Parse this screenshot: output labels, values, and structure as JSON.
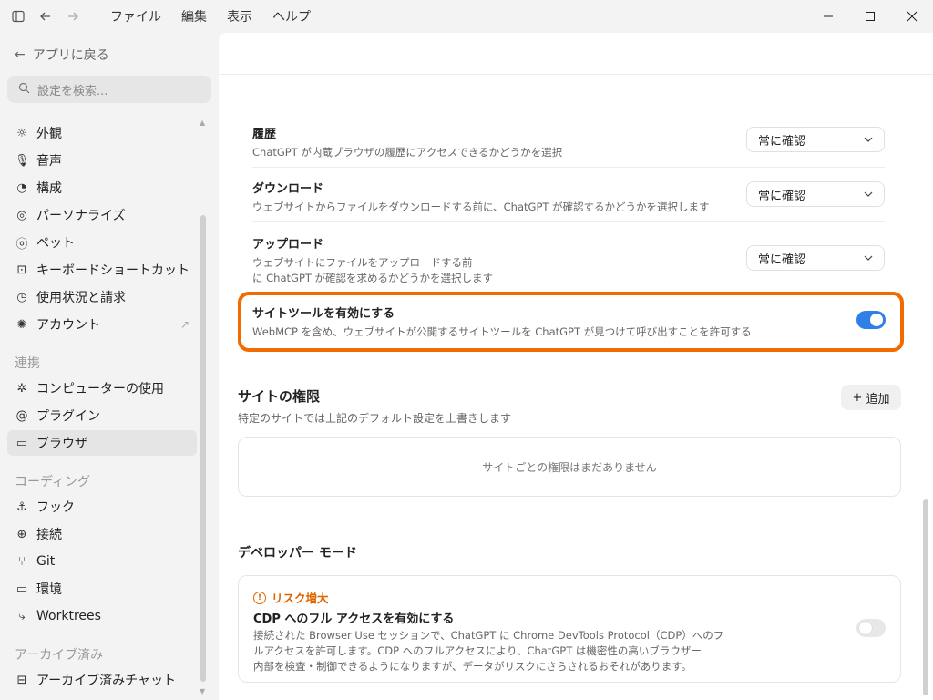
{
  "menu": [
    "ファイル",
    "編集",
    "表示",
    "ヘルプ"
  ],
  "sidebar": {
    "back_label": "アプリに戻る",
    "search_placeholder": "設定を検索...",
    "items": [
      {
        "label": "外観",
        "icon": "sun-icon"
      },
      {
        "label": "音声",
        "icon": "mic-icon"
      },
      {
        "label": "構成",
        "icon": "config-icon"
      },
      {
        "label": "パーソナライズ",
        "icon": "personalize-icon"
      },
      {
        "label": "ペット",
        "icon": "pet-icon"
      },
      {
        "label": "キーボードショートカット",
        "icon": "keyboard-icon"
      },
      {
        "label": "使用状況と請求",
        "icon": "gauge-icon"
      },
      {
        "label": "アカウント",
        "icon": "account-icon"
      }
    ],
    "section_integrations": "連携",
    "integrations": [
      {
        "label": "コンピューターの使用",
        "icon": "computer-use-icon"
      },
      {
        "label": "プラグイン",
        "icon": "plugin-icon"
      },
      {
        "label": "ブラウザ",
        "icon": "browser-icon"
      }
    ],
    "section_coding": "コーディング",
    "coding": [
      {
        "label": "フック",
        "icon": "hook-icon"
      },
      {
        "label": "接続",
        "icon": "globe-icon"
      },
      {
        "label": "Git",
        "icon": "git-icon"
      },
      {
        "label": "環境",
        "icon": "environment-icon"
      },
      {
        "label": "Worktrees",
        "icon": "worktree-icon"
      }
    ],
    "section_archived": "アーカイブ済み",
    "archived": [
      {
        "label": "アーカイブ済みチャット",
        "icon": "archive-icon"
      }
    ]
  },
  "settings": {
    "history": {
      "title": "履歴",
      "desc": "ChatGPT が内蔵ブラウザの履歴にアクセスできるかどうかを選択",
      "value": "常に確認"
    },
    "download": {
      "title": "ダウンロード",
      "desc": "ウェブサイトからファイルをダウンロードする前に、ChatGPT が確認するかどうかを選択します",
      "value": "常に確認"
    },
    "upload": {
      "title": "アップロード",
      "desc1": "ウェブサイトにファイルをアップロードする前",
      "desc2": "に ChatGPT が確認を求めるかどうかを選択します",
      "value": "常に確認"
    },
    "site_tools": {
      "title": "サイトツールを有効にする",
      "desc": "WebMCP を含め、ウェブサイトが公開するサイトツールを ChatGPT が見つけて呼び出すことを許可する",
      "enabled": true
    }
  },
  "site_permissions": {
    "title": "サイトの権限",
    "subtitle": "特定のサイトでは上記のデフォルト設定を上書きします",
    "add_label": "追加",
    "empty": "サイトごとの権限はまだありません"
  },
  "developer": {
    "title": "デベロッパー モード",
    "risk_label": "リスク増大",
    "cdp_title": "CDP へのフル アクセスを有効にする",
    "cdp_desc1": "接続された Browser Use セッションで、ChatGPT に Chrome DevTools Protocol（CDP）へのフ",
    "cdp_desc2": "ルアクセスを許可します。CDP へのフルアクセスにより、ChatGPT は機密性の高いブラウザー",
    "cdp_desc3": "内部を検査・制御できるようになりますが、データがリスクにさらされるおそれがあります。",
    "enabled": false
  },
  "colors": {
    "accent": "#2f7fe6",
    "highlight": "#f26b00",
    "risk": "#e06400"
  }
}
